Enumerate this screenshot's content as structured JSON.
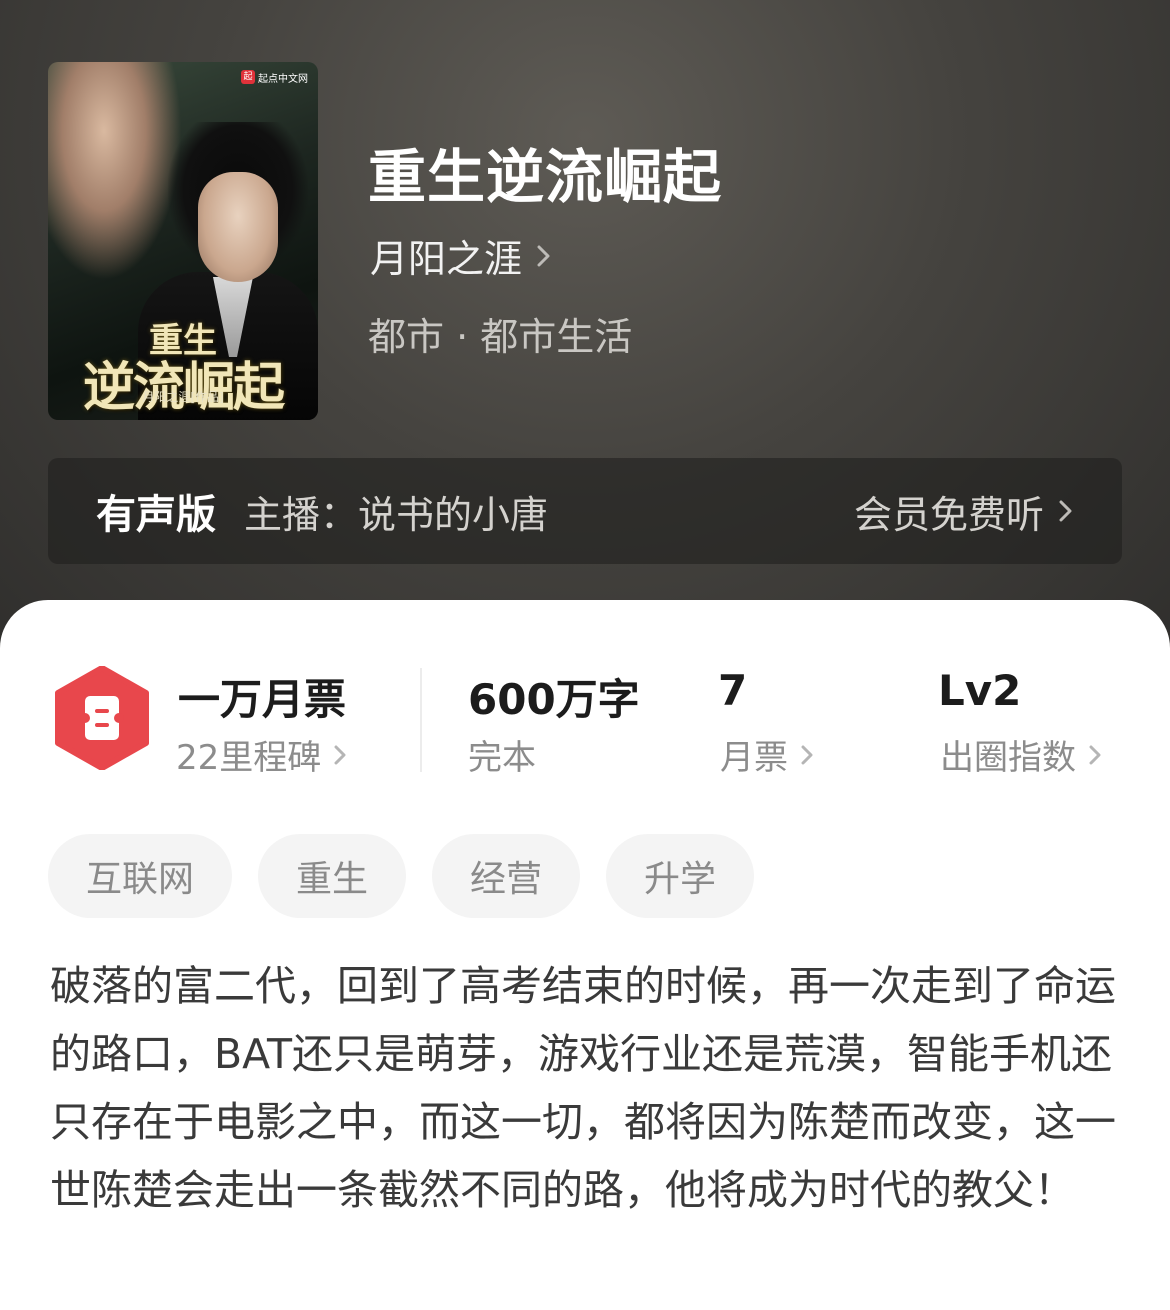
{
  "cover": {
    "brand": "起点中文网",
    "brand_mark": "起",
    "title_line1": "重生",
    "title_line2": "逆流崛起",
    "author_line": "月阳之涯[作品]"
  },
  "book": {
    "title": "重生逆流崛起",
    "author": "月阳之涯",
    "category": "都市 · 都市生活"
  },
  "audio": {
    "tag": "有声版",
    "host": "主播：说书的小唐",
    "cta": "会员免费听"
  },
  "stats": {
    "ticket_title": "一万月票",
    "ticket_sub": "22里程碑",
    "words_value": "600万字",
    "words_sub": "完本",
    "monthly_value": "7",
    "monthly_sub": "月票",
    "level_value": "Lv2",
    "level_sub": "出圈指数"
  },
  "tags": [
    "互联网",
    "重生",
    "经营",
    "升学"
  ],
  "description": "破落的富二代，回到了高考结束的时候，再一次走到了命运的路口，BAT还只是萌芽，游戏行业还是荒漠，智能手机还只存在于电影之中，而这一切，都将因为陈楚而改变，这一世陈楚会走出一条截然不同的路，他将成为时代的教父！",
  "colors": {
    "accent_red": "#e8474c",
    "header_bg": "#45433f"
  }
}
